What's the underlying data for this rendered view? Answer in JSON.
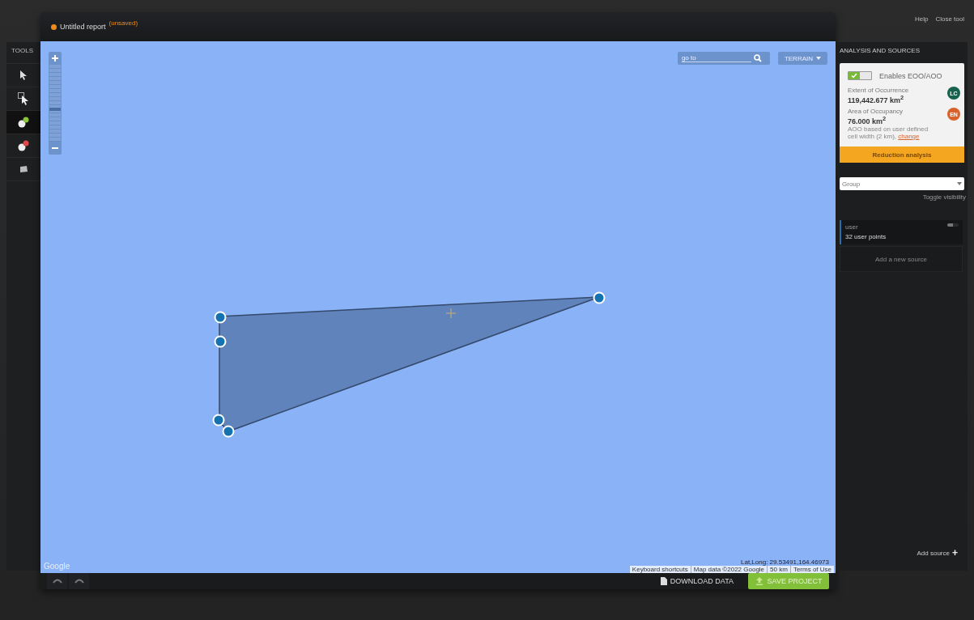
{
  "top_links": [
    "Help",
    "Close tool"
  ],
  "report": {
    "title": "Untitled report",
    "status": "(unsaved)"
  },
  "tools": {
    "title": "TOOLS",
    "items": [
      {
        "kind": "select",
        "selected": false
      },
      {
        "kind": "box-select",
        "selected": false
      },
      {
        "kind": "add-point",
        "selected": true
      },
      {
        "kind": "remove-point",
        "selected": false
      },
      {
        "kind": "layers",
        "selected": false
      }
    ]
  },
  "map": {
    "zoom": {
      "level": 0.4
    },
    "search": {
      "placeholder": "go to"
    },
    "map_type": "TERRAIN",
    "logo": "Google",
    "coordinates": "Lat,Long: 29.53491,164.46973",
    "attribution": [
      "Keyboard shortcuts",
      "Map data ©2022 Google",
      "50 km",
      "Terms of Use"
    ]
  },
  "bottom_bar": {
    "download": "DOWNLOAD DATA",
    "save": "SAVE PROJECT"
  },
  "panel": {
    "title": "ANALYSIS AND SOURCES",
    "analysis": {
      "on": true,
      "toggle_label": "Enables EOO/AOO",
      "eoo": {
        "label": "Extent of Occurrence",
        "value": "119,442.677 km$^{2}$",
        "badge": "LC",
        "color": "#17614f"
      },
      "aoo": {
        "label": "Area of Occupancy",
        "value": "76.000 km$^{2}$",
        "badge": "EN",
        "color": "#d8622c"
      },
      "note": "AOO based on user defined cell width (2 km),",
      "note_link": "change",
      "button": "Reduction analysis"
    },
    "group": {
      "value": "Group"
    },
    "toggle_visibility": "Toggle visibility",
    "sources": [
      {
        "name": "user",
        "count": "32 user points",
        "visible": true
      }
    ],
    "add_new": "Add a new source",
    "add_source": "Add source",
    "add_icon": "+"
  }
}
